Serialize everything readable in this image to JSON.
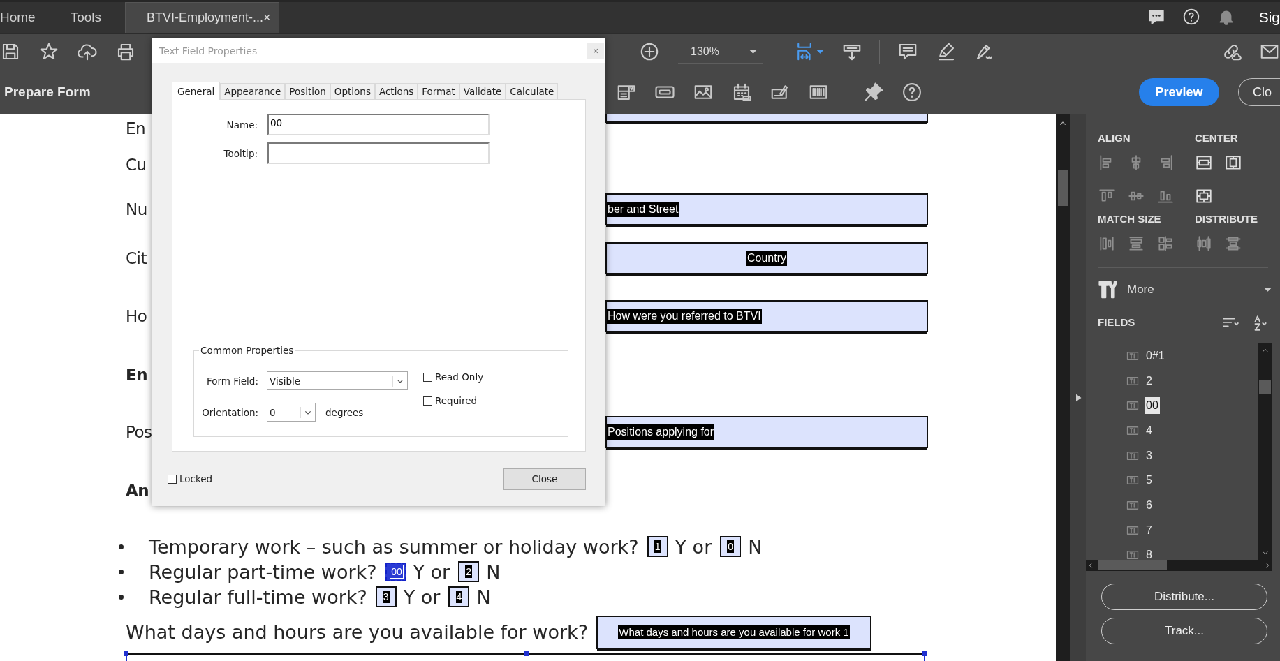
{
  "app_tabs": [
    {
      "label": "Home",
      "selected": false
    },
    {
      "label": "Tools",
      "selected": false
    },
    {
      "label": "BTVI-Employment-...",
      "selected": true,
      "close": "×"
    }
  ],
  "account": {
    "label": "Sig"
  },
  "toolbar": {
    "zoom": "130%"
  },
  "form_bar": {
    "title": "Prepare Form",
    "preview": "Preview",
    "close": "Clo"
  },
  "document": {
    "rows": [
      {
        "label": "En",
        "bold": false,
        "field": {
          "kind": "text-box"
        }
      },
      {
        "label": "Cu",
        "bold": false
      },
      {
        "label": "Nu",
        "bold": false,
        "field": {
          "kind": "text-box",
          "text": "ber and Street",
          "centered": false
        }
      },
      {
        "label": "Cit",
        "bold": false,
        "field": {
          "kind": "text-box",
          "text": "Country",
          "centered": true
        }
      },
      {
        "label": "Ho",
        "bold": false,
        "field": {
          "kind": "text-box",
          "text": "How were you referred to BTVI",
          "centered": false
        }
      },
      {
        "label": "En",
        "bold": true
      },
      {
        "label": "Pos",
        "bold": false,
        "field": {
          "kind": "text-box",
          "text": "Positions applying for",
          "centered": false
        }
      },
      {
        "label": "An",
        "bold": true
      }
    ],
    "bullets": [
      {
        "question": "Temporary work – such as summer or holiday work?",
        "yes_field": {
          "text": "1",
          "selected": false
        },
        "yes": "Y or",
        "no_field": {
          "text": "0",
          "selected": false
        },
        "no": "N"
      },
      {
        "question": "Regular part-time work?",
        "yes_field": {
          "text": "00",
          "selected": true
        },
        "yes": "Y or",
        "no_field": {
          "text": "2",
          "selected": false
        },
        "no": "N"
      },
      {
        "question": "Regular full-time work?",
        "yes_field": {
          "text": "3",
          "selected": false
        },
        "yes": "Y or",
        "no_field": {
          "text": "4",
          "selected": false
        },
        "no": "N"
      }
    ],
    "availability": {
      "question": "What days and hours are you available for work?",
      "field": "What days and hours are you available for work 1"
    }
  },
  "dialog": {
    "title": "Text Field Properties",
    "close": "×",
    "tabs": [
      {
        "label": "General",
        "selected": true
      },
      {
        "label": "Appearance",
        "selected": false
      },
      {
        "label": "Position",
        "selected": false
      },
      {
        "label": "Options",
        "selected": false
      },
      {
        "label": "Actions",
        "selected": false
      },
      {
        "label": "Format",
        "selected": false
      },
      {
        "label": "Validate",
        "selected": false
      },
      {
        "label": "Calculate",
        "selected": false
      }
    ],
    "name": {
      "label": "Name:",
      "value": "00"
    },
    "tooltip": {
      "label": "Tooltip:"
    },
    "group": "Common Properties",
    "form_field": {
      "label": "Form Field:",
      "value": "Visible"
    },
    "orientation": {
      "label": "Orientation:",
      "value": "0",
      "unit": "degrees"
    },
    "options": [
      {
        "label": "Read Only",
        "checked": false
      },
      {
        "label": "Required",
        "checked": false
      }
    ],
    "locked": {
      "label": "Locked",
      "checked": false
    },
    "button": "Close"
  },
  "panel": {
    "headings": [
      "ALIGN",
      "CENTER",
      "MATCH SIZE",
      "DISTRIBUTE"
    ],
    "more": "More",
    "fields_title": "FIELDS",
    "fields": [
      {
        "name": "0#1",
        "selected": false
      },
      {
        "name": "2",
        "selected": false
      },
      {
        "name": "00",
        "selected": true
      },
      {
        "name": "4",
        "selected": false
      },
      {
        "name": "3",
        "selected": false
      },
      {
        "name": "5",
        "selected": false
      },
      {
        "name": "6",
        "selected": false
      },
      {
        "name": "7",
        "selected": false
      },
      {
        "name": "8",
        "selected": false
      }
    ],
    "buttons": [
      "Distribute...",
      "Track..."
    ]
  }
}
